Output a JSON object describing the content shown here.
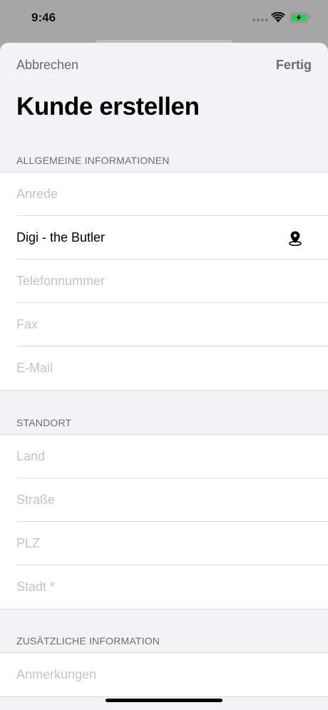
{
  "status_bar": {
    "time": "9:46",
    "icons": [
      "signal-icon",
      "wifi-icon",
      "battery-charging-icon"
    ],
    "battery_color": "#34c759"
  },
  "nav": {
    "cancel_label": "Abbrechen",
    "done_label": "Fertig",
    "title": "Kunde erstellen"
  },
  "sections": {
    "general": {
      "header": "ALLGEMEINE INFORMATIONEN",
      "salutation_placeholder": "Anrede",
      "name_value": "Digi - the Butler",
      "phone_placeholder": "Telefonnummer",
      "fax_placeholder": "Fax",
      "email_placeholder": "E-Mail",
      "name_icon": "location-pin-icon"
    },
    "location": {
      "header": "STANDORT",
      "country_placeholder": "Land",
      "street_placeholder": "Straße",
      "zip_placeholder": "PLZ",
      "city_placeholder": "Stadt *"
    },
    "additional": {
      "header": "ZUSÄTZLICHE INFORMATION",
      "notes_placeholder": "Anmerkungen"
    }
  },
  "colors": {
    "background": "#f2f2f7",
    "placeholder": "#c4c4c8",
    "nav_text": "#6b6b70"
  }
}
